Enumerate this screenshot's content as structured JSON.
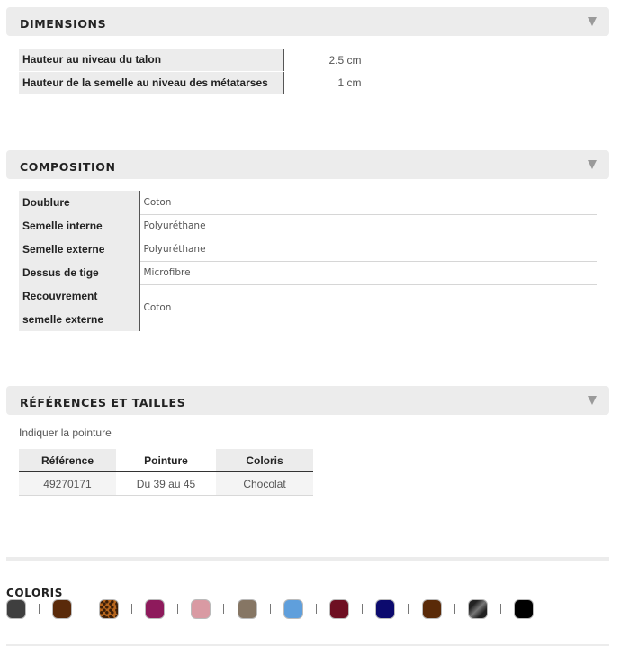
{
  "dimensions": {
    "title": "DIMENSIONS",
    "rows": [
      {
        "label": "Hauteur au niveau du talon",
        "value": "2.5 cm"
      },
      {
        "label": "Hauteur de la semelle au niveau des métatarses",
        "value": "1 cm"
      }
    ]
  },
  "composition": {
    "title": "COMPOSITION",
    "rows": [
      {
        "label": "Doublure",
        "value": "Coton"
      },
      {
        "label": "Semelle interne",
        "value": "Polyuréthane"
      },
      {
        "label": "Semelle externe",
        "value": "Polyuréthane"
      },
      {
        "label": "Dessus de tige",
        "value": "Microfibre"
      },
      {
        "label": "Recouvrement semelle externe",
        "value": "Coton"
      }
    ]
  },
  "references": {
    "title": "RÉFÉRENCES ET TAILLES",
    "hint": "Indiquer la pointure",
    "headers": [
      "Référence",
      "Pointure",
      "Coloris"
    ],
    "rows": [
      [
        "49270171",
        "Du 39 au 45",
        "Chocolat"
      ]
    ]
  },
  "coloris": {
    "label": "COLORIS",
    "swatches": [
      {
        "name": "dark-grey",
        "color": "#3f3f3f"
      },
      {
        "name": "chocolate",
        "color": "#5a2a0a"
      },
      {
        "name": "leopard",
        "color": "#b5651d"
      },
      {
        "name": "magenta",
        "color": "#8e1a5c"
      },
      {
        "name": "pink",
        "color": "#d99aa3"
      },
      {
        "name": "taupe",
        "color": "#867664"
      },
      {
        "name": "light-blue",
        "color": "#5f9fdc"
      },
      {
        "name": "burgundy",
        "color": "#6e0f22"
      },
      {
        "name": "navy",
        "color": "#0c0a6e"
      },
      {
        "name": "brown",
        "color": "#5a2a08"
      },
      {
        "name": "grey-pattern",
        "color": "#3a3a3a"
      },
      {
        "name": "black",
        "color": "#000000"
      }
    ]
  }
}
